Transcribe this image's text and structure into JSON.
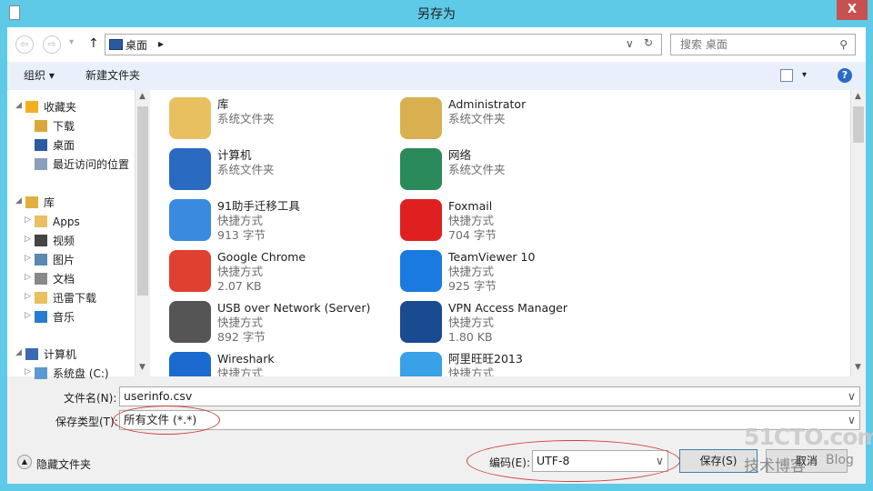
{
  "window": {
    "title": "另存为",
    "close": "X"
  },
  "nav": {
    "back": "⇦",
    "forward": "⇨",
    "recent": "▾",
    "up": "↑",
    "address": "桌面",
    "address_arrow": "▸",
    "address_dropdown": "∨",
    "refresh": "↻",
    "search_placeholder": "搜索 桌面",
    "search_icon": "⚲"
  },
  "toolbar": {
    "organize": "组织 ▾",
    "new_folder": "新建文件夹",
    "view": "▾",
    "help": "?"
  },
  "sidebar": {
    "items": [
      {
        "label": "收藏夹",
        "icon": "star-icon",
        "color": "#f0b020"
      },
      {
        "label": "下载",
        "icon": "download-icon",
        "color": "#d9a83a"
      },
      {
        "label": "桌面",
        "icon": "desktop-icon",
        "color": "#2a5aa0"
      },
      {
        "label": "最近访问的位置",
        "icon": "recent-icon",
        "color": "#8aa0b8"
      },
      {
        "label": "库",
        "icon": "library-icon",
        "color": "#e0b040"
      },
      {
        "label": "Apps",
        "icon": "folder-icon",
        "color": "#e8c060"
      },
      {
        "label": "视频",
        "icon": "video-icon",
        "color": "#444"
      },
      {
        "label": "图片",
        "icon": "picture-icon",
        "color": "#5a8ab0"
      },
      {
        "label": "文档",
        "icon": "document-icon",
        "color": "#888"
      },
      {
        "label": "迅雷下载",
        "icon": "folder-icon",
        "color": "#e8c060"
      },
      {
        "label": "音乐",
        "icon": "music-icon",
        "color": "#2a7ad0"
      },
      {
        "label": "计算机",
        "icon": "computer-icon",
        "color": "#3a6ab0"
      },
      {
        "label": "系统盘 (C:)",
        "icon": "drive-icon",
        "color": "#5a9ad0"
      }
    ]
  },
  "files": [
    {
      "name": "库",
      "sub1": "系统文件夹",
      "sub2": "",
      "icon": "library-icon",
      "color": "#e8c060"
    },
    {
      "name": "Administrator",
      "sub1": "系统文件夹",
      "sub2": "",
      "icon": "user-folder-icon",
      "color": "#d8b050"
    },
    {
      "name": "计算机",
      "sub1": "系统文件夹",
      "sub2": "",
      "icon": "computer-icon",
      "color": "#2a6ac0"
    },
    {
      "name": "网络",
      "sub1": "系统文件夹",
      "sub2": "",
      "icon": "network-icon",
      "color": "#2a8a5a"
    },
    {
      "name": "91助手迁移工具",
      "sub1": "快捷方式",
      "sub2": "913 字节",
      "icon": "app-91-icon",
      "color": "#3a8ae0"
    },
    {
      "name": "Foxmail",
      "sub1": "快捷方式",
      "sub2": "704 字节",
      "icon": "foxmail-icon",
      "color": "#e02020"
    },
    {
      "name": "Google Chrome",
      "sub1": "快捷方式",
      "sub2": "2.07 KB",
      "icon": "chrome-icon",
      "color": "#e04030"
    },
    {
      "name": "TeamViewer 10",
      "sub1": "快捷方式",
      "sub2": "925 字节",
      "icon": "teamviewer-icon",
      "color": "#1a7ae0"
    },
    {
      "name": "USB over Network (Server)",
      "sub1": "快捷方式",
      "sub2": "892 字节",
      "icon": "usb-icon",
      "color": "#555"
    },
    {
      "name": "VPN Access Manager",
      "sub1": "快捷方式",
      "sub2": "1.80 KB",
      "icon": "vpn-lock-icon",
      "color": "#1a4a90"
    },
    {
      "name": "Wireshark",
      "sub1": "快捷方式",
      "sub2": "",
      "icon": "wireshark-icon",
      "color": "#1a6ad0"
    },
    {
      "name": "阿里旺旺2013",
      "sub1": "快捷方式",
      "sub2": "",
      "icon": "aliwangwang-icon",
      "color": "#3aa0e8"
    }
  ],
  "form": {
    "filename_label": "文件名(N):",
    "filename": "userinfo.csv",
    "type_label": "保存类型(T):",
    "type": "所有文件  (*.*)",
    "encoding_label": "编码(E):",
    "encoding": "UTF-8",
    "hide_folders": "隐藏文件夹",
    "save": "保存(S)",
    "cancel": "取消"
  },
  "watermark": {
    "line1": "51CTO.com",
    "line2": "技术博客",
    "line3": "Blog"
  }
}
